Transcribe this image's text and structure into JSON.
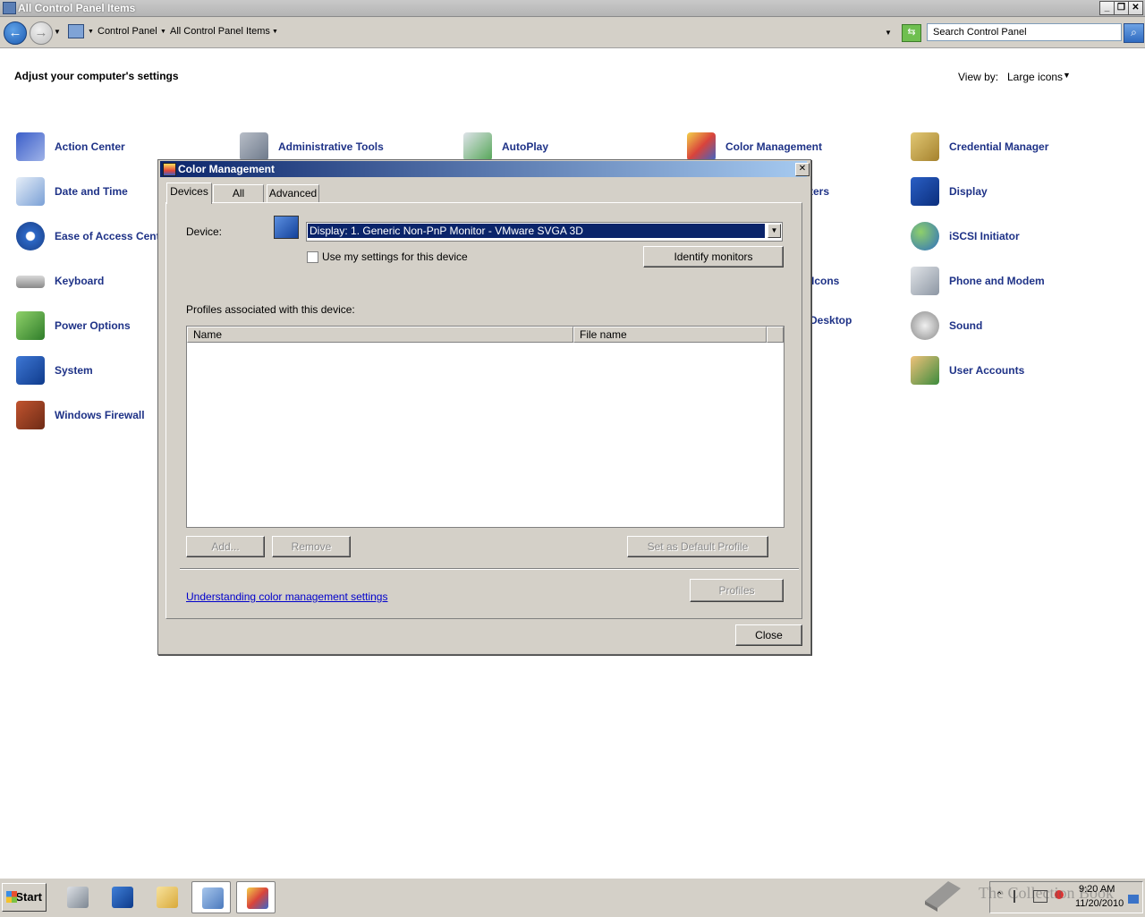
{
  "window": {
    "title": "All Control Panel Items"
  },
  "address": {
    "crumbs": [
      "Control Panel",
      "All Control Panel Items"
    ],
    "search_placeholder": "Search Control Panel"
  },
  "content": {
    "heading": "Adjust your computer's settings",
    "view_by_label": "View by:",
    "view_by_value": "Large icons",
    "items": [
      {
        "label": "Action Center",
        "icon": "flag-icon"
      },
      {
        "label": "Administrative Tools",
        "icon": "admin-tools-icon"
      },
      {
        "label": "AutoPlay",
        "icon": "autoplay-icon"
      },
      {
        "label": "Color Management",
        "icon": "color-management-icon"
      },
      {
        "label": "Credential Manager",
        "icon": "credential-manager-icon"
      },
      {
        "label": "Date and Time",
        "icon": "calendar-clock-icon"
      },
      {
        "label": "Display",
        "icon": "display-icon"
      },
      {
        "label": "Ease of Access Cente",
        "icon": "ease-of-access-icon"
      },
      {
        "label": "iSCSI Initiator",
        "icon": "iscsi-icon"
      },
      {
        "label": "Keyboard",
        "icon": "keyboard-icon"
      },
      {
        "label": "Phone and Modem",
        "icon": "phone-icon"
      },
      {
        "label": "Power Options",
        "icon": "battery-icon"
      },
      {
        "label": "Sound",
        "icon": "speaker-icon"
      },
      {
        "label": "System",
        "icon": "system-icon"
      },
      {
        "label": "User Accounts",
        "icon": "users-icon"
      },
      {
        "label": "Windows Firewall",
        "icon": "firewall-icon"
      },
      {
        "label": "ters",
        "icon": ""
      },
      {
        "label": "Icons",
        "icon": ""
      },
      {
        "label": "Desktop",
        "icon": ""
      }
    ]
  },
  "dialog": {
    "title": "Color Management",
    "tabs": [
      "Devices",
      "All Profiles",
      "Advanced"
    ],
    "device_label": "Device:",
    "device_value": "Display: 1. Generic Non-PnP Monitor - VMware SVGA 3D",
    "use_my_settings": "Use my settings for this device",
    "identify_monitors": "Identify monitors",
    "profiles_label": "Profiles associated with this device:",
    "columns": [
      "Name",
      "File name"
    ],
    "add": "Add...",
    "remove": "Remove",
    "set_default": "Set as Default Profile",
    "help_link": "Understanding color management settings",
    "profiles": "Profiles",
    "close": "Close"
  },
  "taskbar": {
    "start": "Start",
    "time": "9:20 AM",
    "date": "11/20/2010",
    "watermark": "The Collection Book"
  }
}
